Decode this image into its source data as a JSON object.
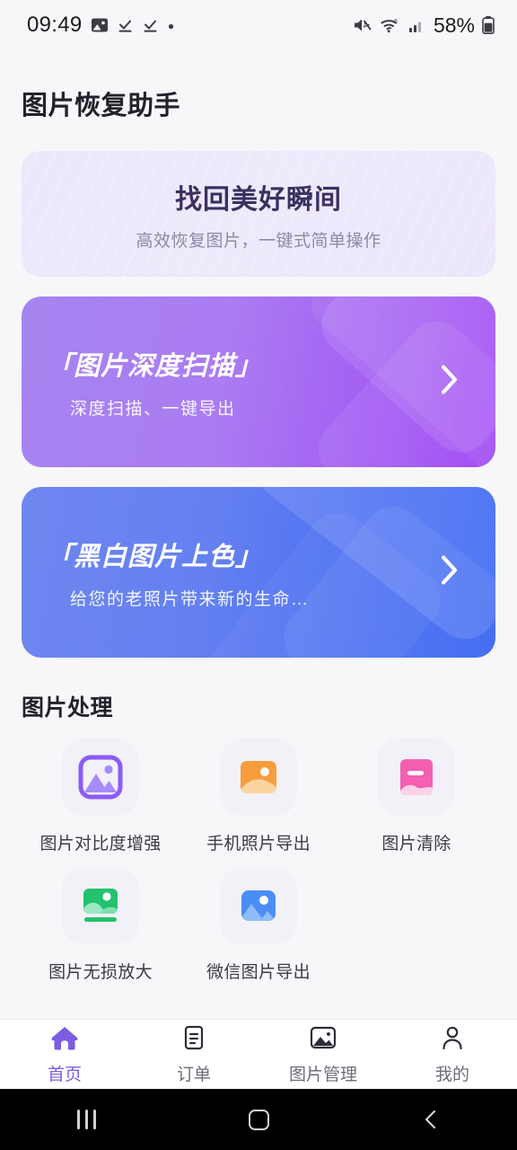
{
  "statusbar": {
    "time": "09:49",
    "battery_percent": "58%",
    "icons": [
      "photo-icon",
      "download-check-icon",
      "download-check-icon",
      "dot-icon",
      "mute-icon",
      "wifi-icon",
      "cellular-signal-icon",
      "battery-icon"
    ]
  },
  "header": {
    "title": "图片恢复助手"
  },
  "hero": {
    "title": "找回美好瞬间",
    "subtitle": "高效恢复图片，一键式简单操作",
    "bg_color": "#ece7fb"
  },
  "feature_cards": [
    {
      "title": "「图片深度扫描」",
      "subtitle": "深度扫描、一键导出",
      "color_start": "#a684ef",
      "color_end": "#9b3ff5",
      "chevron": "chevron-right-icon"
    },
    {
      "title": "「黑白图片上色」",
      "subtitle": "给您的老照片带来新的生命…",
      "color_start": "#6f86ef",
      "color_end": "#3764f2",
      "chevron": "chevron-right-icon"
    }
  ],
  "section": {
    "title": "图片处理",
    "items": [
      {
        "label": "图片对比度增强",
        "icon": "photo-enhance-icon",
        "color": "#8b5cf6"
      },
      {
        "label": "手机照片导出",
        "icon": "photo-export-icon",
        "color": "#f79d3c"
      },
      {
        "label": "图片清除",
        "icon": "photo-erase-icon",
        "color": "#f45fb0"
      },
      {
        "label": "图片无损放大",
        "icon": "photo-upscale-icon",
        "color": "#23c26e"
      },
      {
        "label": "微信图片导出",
        "icon": "photo-wechat-icon",
        "color": "#4a8ef5"
      }
    ]
  },
  "tabbar": {
    "accent_color": "#7c5ce0",
    "tabs": [
      {
        "label": "首页",
        "icon": "home-icon",
        "active": true
      },
      {
        "label": "订单",
        "icon": "order-icon",
        "active": false
      },
      {
        "label": "图片管理",
        "icon": "gallery-icon",
        "active": false
      },
      {
        "label": "我的",
        "icon": "person-icon",
        "active": false
      }
    ]
  },
  "navbar": {
    "buttons": [
      "recents-icon",
      "home-circle-icon",
      "back-icon"
    ]
  }
}
